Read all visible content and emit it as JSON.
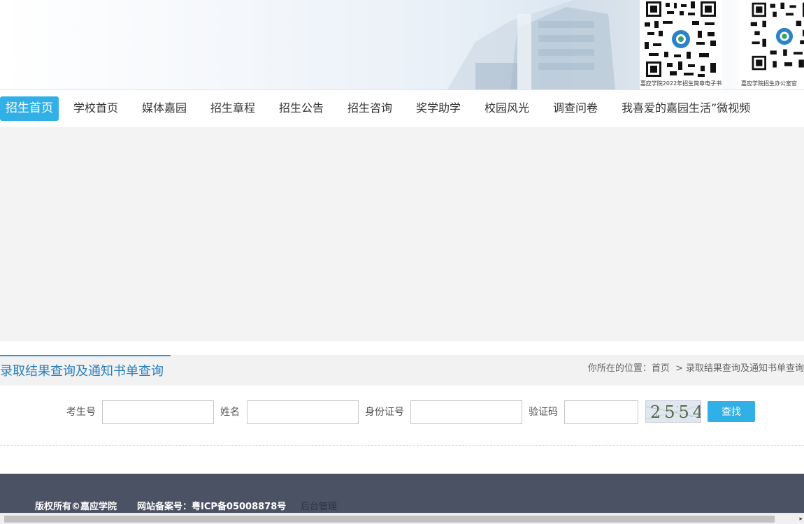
{
  "banner": {
    "qr1_caption": "嘉应学院2022年招生简章电子书",
    "qr2_caption": "嘉应学院招生办公室官"
  },
  "nav": {
    "items": [
      {
        "label": "招生首页",
        "active": true
      },
      {
        "label": "学校首页"
      },
      {
        "label": "媒体嘉园"
      },
      {
        "label": "招生章程"
      },
      {
        "label": "招生公告"
      },
      {
        "label": "招生咨询"
      },
      {
        "label": "奖学助学"
      },
      {
        "label": "校园风光"
      },
      {
        "label": "调查问卷"
      },
      {
        "label": "我喜爱的嘉园生活”微视频"
      }
    ]
  },
  "section": {
    "title": "录取结果查询及通知书单查询",
    "crumb_prefix": "你所在的位置：",
    "crumb_home": "首页",
    "crumb_sep": ">",
    "crumb_current": "录取结果查询及通知书单查询"
  },
  "form": {
    "exam_no_label": "考生号",
    "name_label": "姓名",
    "id_label": "身份证号",
    "captcha_label": "验证码",
    "captcha_text": "2554",
    "submit_label": "查找"
  },
  "footer": {
    "copyright": "版权所有©嘉应学院",
    "icp": "网站备案号：粤ICP备05008878号",
    "admin": "后台管理"
  },
  "colors": {
    "accent": "#31b0e8",
    "title_blue": "#2a7fc0",
    "footer_bg": "#4b5264"
  }
}
